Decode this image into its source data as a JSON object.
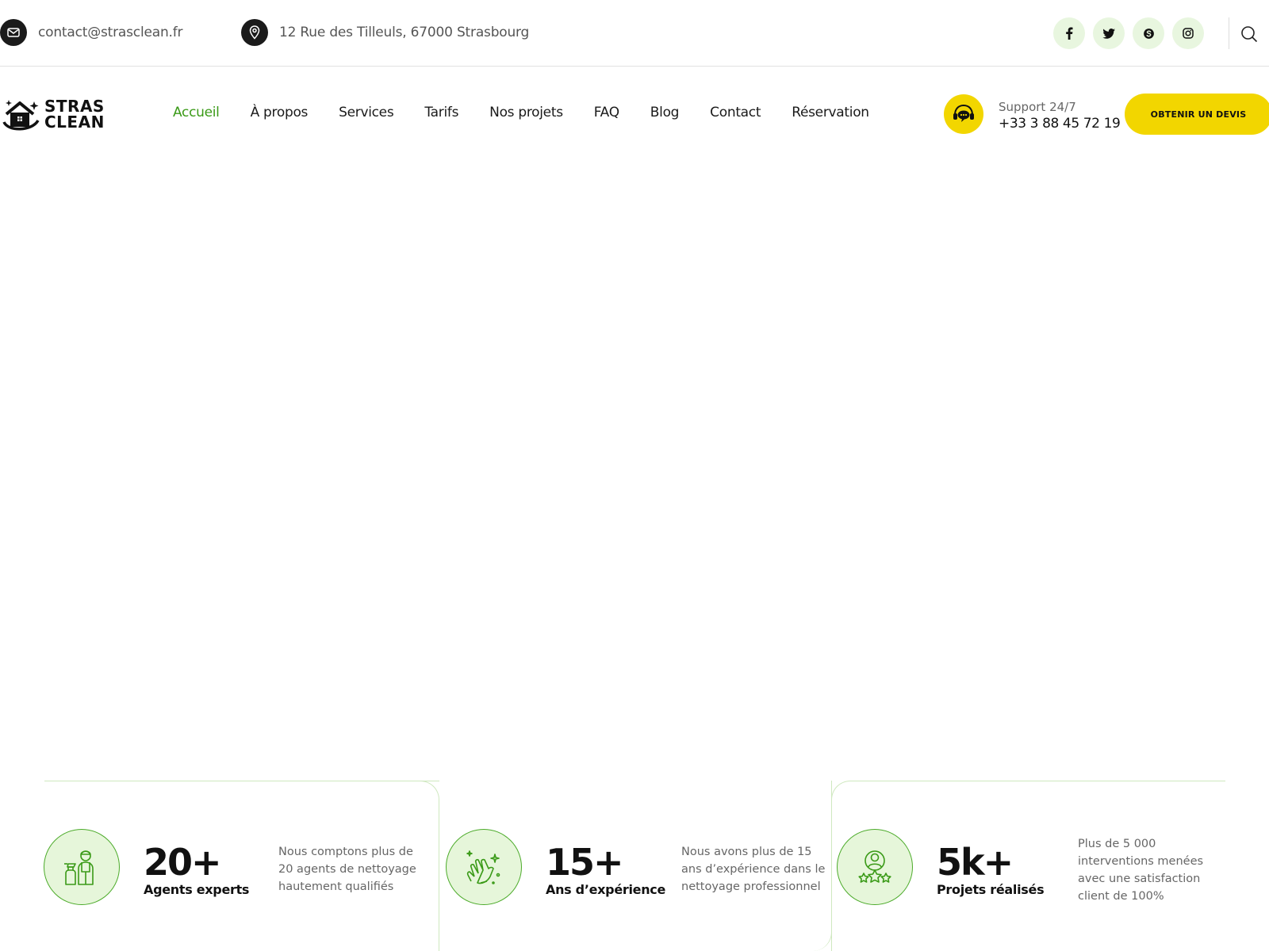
{
  "topbar": {
    "email": "contact@strasclean.fr",
    "address": "12 Rue des Tilleuls, 67000 Strasbourg",
    "email_icon": "mail-icon",
    "address_icon": "map-pin-icon",
    "socials": [
      {
        "name": "facebook-icon",
        "glyph": "f"
      },
      {
        "name": "twitter-icon",
        "glyph": "t"
      },
      {
        "name": "skype-icon",
        "glyph": "S"
      },
      {
        "name": "instagram-icon",
        "glyph": "◎"
      }
    ],
    "search_icon": "search-icon"
  },
  "header": {
    "logo_line1": "STRAS",
    "logo_line2": "CLEAN",
    "nav": [
      {
        "label": "Accueil",
        "active": true
      },
      {
        "label": "À propos",
        "active": false
      },
      {
        "label": "Services",
        "active": false
      },
      {
        "label": "Tarifs",
        "active": false
      },
      {
        "label": "Nos projets",
        "active": false
      },
      {
        "label": "FAQ",
        "active": false
      },
      {
        "label": "Blog",
        "active": false
      },
      {
        "label": "Contact",
        "active": false
      },
      {
        "label": "Réservation",
        "active": false
      }
    ],
    "support_label": "Support 24/7",
    "support_phone": "+33 3 88 45 72 19",
    "cta_label": "OBTENIR UN DEVIS"
  },
  "stats": [
    {
      "number": "20+",
      "label": "Agents experts",
      "description": "Nous comptons plus de 20 agents de nettoyage hautement qualifiés",
      "icon": "cleaning-agent-icon"
    },
    {
      "number": "15+",
      "label": "Ans d’expérience",
      "description": "Nous avons plus de 15 ans d’expérience dans le nettoyage professionnel",
      "icon": "clean-hands-icon"
    },
    {
      "number": "5k+",
      "label": "Projets réalisés",
      "description": "Plus de 5 000 interventions menées avec une satisfaction client de 100%",
      "icon": "customer-rating-icon"
    }
  ],
  "colors": {
    "accent_green": "#3a9a17",
    "accent_yellow": "#f2d600",
    "light_green": "#e6f6da"
  }
}
